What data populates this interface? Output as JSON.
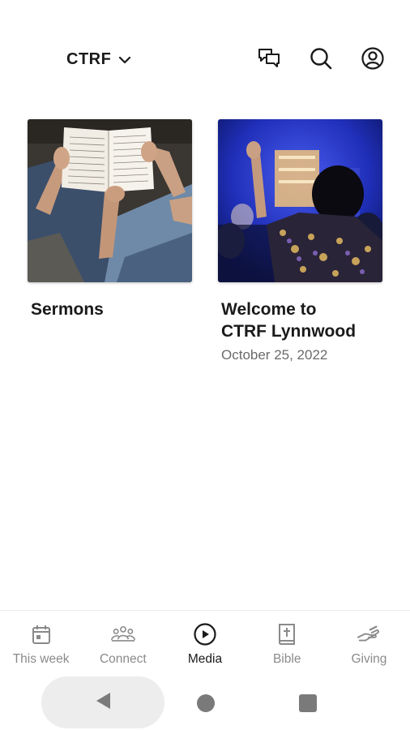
{
  "header": {
    "brand": "CTRF",
    "icons": [
      "messages-icon",
      "search-icon",
      "account-icon"
    ]
  },
  "cards": [
    {
      "title": "Sermons",
      "date": "",
      "image": "open-bible-photo"
    },
    {
      "title": "Welcome to\nCTRF Lynnwood",
      "date": "October 25, 2022",
      "image": "worship-hand-raised-photo"
    }
  ],
  "nav": {
    "items": [
      {
        "label": "This week",
        "icon": "calendar-icon",
        "active": false
      },
      {
        "label": "Connect",
        "icon": "people-icon",
        "active": false
      },
      {
        "label": "Media",
        "icon": "play-circle-icon",
        "active": true
      },
      {
        "label": "Bible",
        "icon": "bible-icon",
        "active": false
      },
      {
        "label": "Giving",
        "icon": "giving-hand-icon",
        "active": false
      }
    ]
  },
  "colors": {
    "text": "#1a1a1a",
    "muted": "#8a8a8a",
    "date": "#6b6b6b",
    "worship_blue": "#1f2fb8"
  }
}
